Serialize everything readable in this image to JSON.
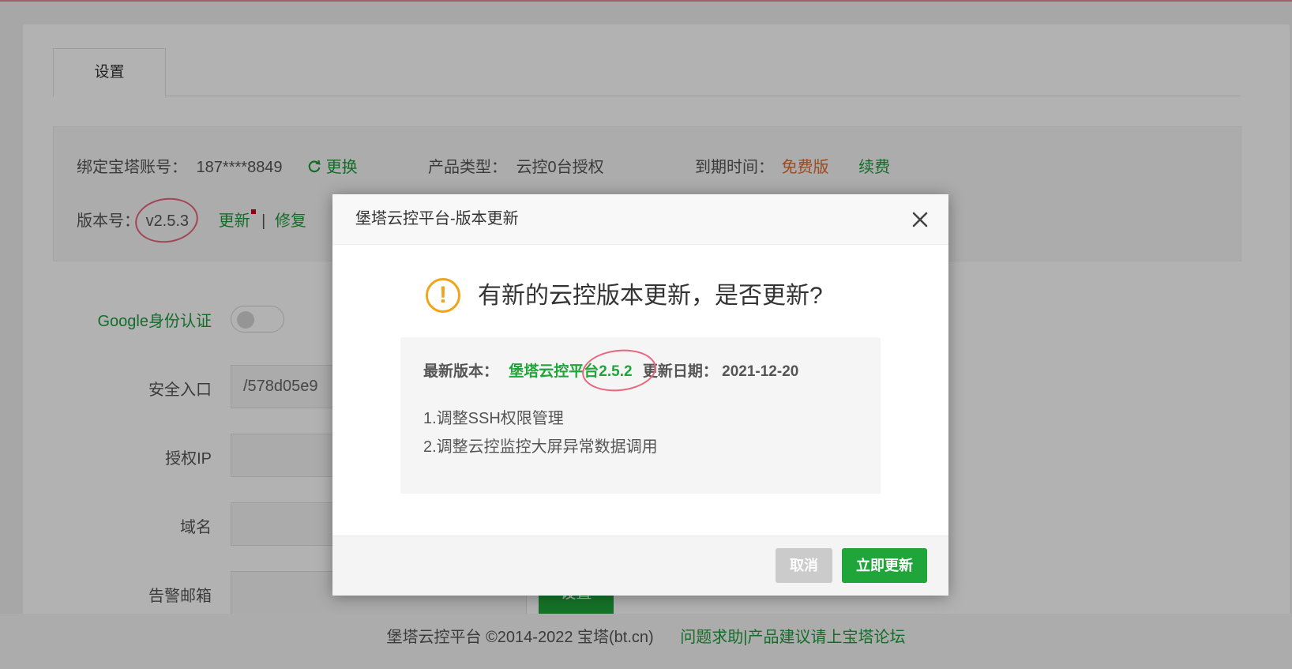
{
  "tabs": [
    {
      "label": "设置"
    }
  ],
  "info": {
    "account_label": "绑定宝塔账号：",
    "account_value": "187****8849",
    "change_link": "更换",
    "product_label": "产品类型：",
    "product_value": "云控0台授权",
    "expire_label": "到期时间：",
    "expire_value": "免费版",
    "renew_link": "续费",
    "version_label": "版本号：",
    "version_value": "v2.5.3",
    "update_link": "更新",
    "separator": "|",
    "repair_link": "修复"
  },
  "form": {
    "google_auth_label": "Google身份认证",
    "security_entry_label": "安全入口",
    "security_entry_value": "/578d05e9",
    "auth_ip_label": "授权IP",
    "domain_label": "域名",
    "alert_email_label": "告警邮箱",
    "set_button": "设置"
  },
  "footer": {
    "copyright": "堡塔云控平台 ©2014-2022 宝塔(bt.cn)",
    "forum_link": "问题求助|产品建议请上宝塔论坛"
  },
  "dialog": {
    "title": "堡塔云控平台-版本更新",
    "question": "有新的云控版本更新，是否更新?",
    "latest_label": "最新版本：",
    "latest_value": "堡塔云控平台2.5.2",
    "date_label": "更新日期：",
    "date_value": "2021-12-20",
    "notes": [
      "1.调整SSH权限管理",
      "2.调整云控监控大屏异常数据调用"
    ],
    "cancel_button": "取消",
    "confirm_button": "立即更新"
  },
  "colors": {
    "accent": "#20a53a",
    "warning": "#f0a41c",
    "expire": "#e26b2b"
  }
}
